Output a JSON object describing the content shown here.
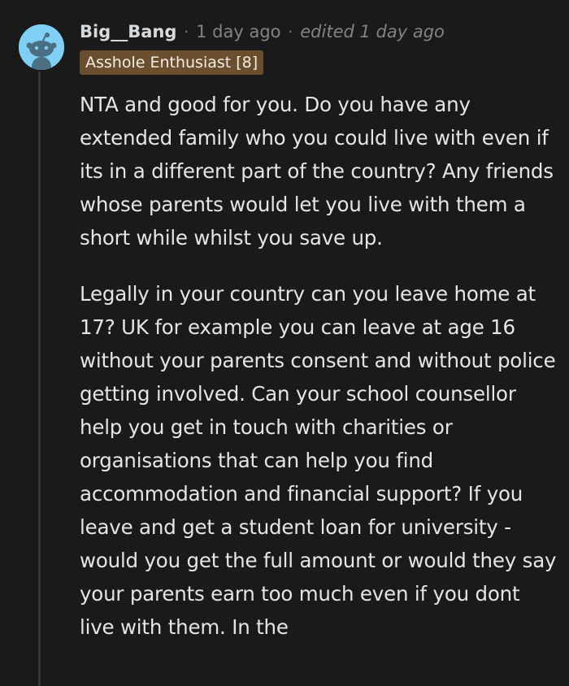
{
  "comment": {
    "username": "Big__Bang",
    "separator": "·",
    "time": "1 day ago",
    "edited": "edited 1 day ago",
    "flair": "Asshole Enthusiast [8]",
    "avatar_icon": "reddit-snoo-avatar-icon",
    "flair_color": "#6b4e2e",
    "paragraphs": [
      "NTA and good for you. Do you have any extended family who you could live with even if its in a different part of the country? Any friends whose parents would let you live with them a short while whilst you save up.",
      "Legally in your country can you leave home at 17? UK for example you can leave at age 16 without your parents consent and without police getting involved. Can your school counsellor help you get in touch with charities or organisations that can help you find accommodation and financial support? If you leave and get a student loan for university - would you get the full amount or would they say your parents earn too much even if you dont live with them. In the"
    ]
  }
}
